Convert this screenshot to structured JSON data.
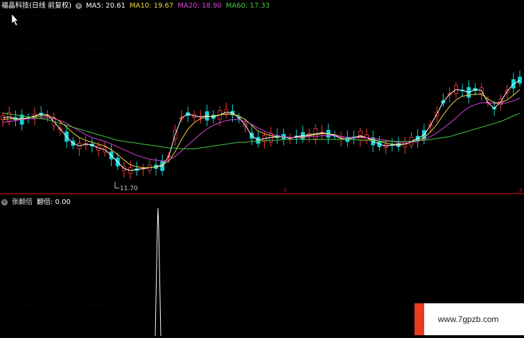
{
  "main_legend": {
    "title": "福晶科技(日线 前复权)",
    "ma5_label": "MA5: 20.61",
    "ma10_label": "MA10: 19.67",
    "ma20_label": "MA20: 18.90",
    "ma60_label": "MA60: 17.33",
    "colors": {
      "title": "#ffffff",
      "ma5": "#ffffff",
      "ma10": "#f5d64a",
      "ma20": "#e040e0",
      "ma60": "#44cc44"
    }
  },
  "main_chart": {
    "low_marker_label": "11.70",
    "axis_marker_left": "S",
    "axis_marker_right": "S"
  },
  "sub_legend": {
    "title": "张翻倍",
    "value_label": "翻倍: 0.00"
  },
  "watermark": {
    "url": "www.7gpzb.com"
  },
  "chart_data": [
    {
      "type": "line",
      "title": "福晶科技(日线 前复权)",
      "series": [
        {
          "name": "MA5",
          "last": 20.61,
          "values": [
            18.6,
            18.7,
            18.5,
            18.4,
            18.6,
            18.8,
            19.0,
            18.9,
            18.2,
            17.4,
            16.6,
            15.9,
            15.6,
            15.8,
            15.7,
            15.4,
            15.2,
            14.6,
            13.9,
            13.2,
            13.0,
            13.1,
            13.2,
            13.3,
            13.4,
            13.5,
            14.5,
            16.8,
            18.6,
            19.0,
            18.8,
            18.7,
            18.8,
            18.7,
            18.9,
            19.2,
            19.1,
            18.6,
            17.8,
            16.7,
            16.2,
            16.4,
            16.5,
            16.6,
            16.6,
            16.4,
            16.6,
            16.7,
            16.8,
            16.9,
            17.0,
            16.9,
            16.7,
            16.4,
            16.3,
            16.5,
            16.7,
            16.5,
            16.1,
            15.8,
            15.6,
            15.7,
            15.7,
            15.8,
            16.1,
            16.4,
            16.8,
            17.8,
            19.0,
            20.3,
            21.1,
            21.6,
            21.5,
            21.3,
            21.6,
            21.5,
            20.2,
            19.6,
            20.3,
            21.4,
            22.2,
            22.6
          ]
        },
        {
          "name": "MA10",
          "last": 19.67,
          "values": [
            18.4,
            18.5,
            18.5,
            18.5,
            18.6,
            18.7,
            18.8,
            18.8,
            18.6,
            18.2,
            17.6,
            17.0,
            16.5,
            16.2,
            16.0,
            15.8,
            15.6,
            15.2,
            14.7,
            14.1,
            13.6,
            13.4,
            13.3,
            13.3,
            13.4,
            13.6,
            14.0,
            15.0,
            16.3,
            17.4,
            18.1,
            18.5,
            18.7,
            18.8,
            18.9,
            19.0,
            19.0,
            18.8,
            18.4,
            17.8,
            17.2,
            16.9,
            16.7,
            16.6,
            16.6,
            16.5,
            16.5,
            16.6,
            16.7,
            16.8,
            16.9,
            16.9,
            16.8,
            16.6,
            16.5,
            16.5,
            16.6,
            16.5,
            16.3,
            16.1,
            15.9,
            15.8,
            15.8,
            15.8,
            16.0,
            16.2,
            16.5,
            17.1,
            17.9,
            18.9,
            19.8,
            20.5,
            20.9,
            21.0,
            21.1,
            21.1,
            20.6,
            20.2,
            20.2,
            20.5,
            21.0,
            21.6
          ]
        },
        {
          "name": "MA20",
          "last": 18.9,
          "values": [
            18.1,
            18.2,
            18.3,
            18.4,
            18.5,
            18.5,
            18.6,
            18.6,
            18.5,
            18.3,
            18.0,
            17.6,
            17.2,
            16.8,
            16.5,
            16.3,
            16.1,
            15.8,
            15.5,
            15.2,
            14.9,
            14.6,
            14.4,
            14.2,
            14.1,
            14.0,
            14.1,
            14.5,
            15.1,
            15.7,
            16.3,
            16.9,
            17.4,
            17.8,
            18.1,
            18.3,
            18.4,
            18.4,
            18.2,
            17.9,
            17.5,
            17.2,
            16.9,
            16.7,
            16.6,
            16.5,
            16.5,
            16.5,
            16.6,
            16.6,
            16.7,
            16.7,
            16.7,
            16.6,
            16.5,
            16.5,
            16.5,
            16.5,
            16.4,
            16.3,
            16.2,
            16.1,
            16.0,
            15.9,
            16.0,
            16.1,
            16.3,
            16.6,
            17.0,
            17.5,
            18.0,
            18.6,
            19.2,
            19.7,
            20.0,
            20.2,
            20.2,
            20.1,
            20.1,
            20.2,
            20.4,
            20.7
          ]
        },
        {
          "name": "MA60",
          "last": 17.33,
          "values": [
            19.1,
            19.0,
            18.9,
            18.8,
            18.7,
            18.6,
            18.5,
            18.4,
            18.2,
            18.0,
            17.8,
            17.6,
            17.4,
            17.2,
            17.0,
            16.8,
            16.6,
            16.4,
            16.2,
            16.1,
            16.0,
            15.9,
            15.8,
            15.7,
            15.6,
            15.5,
            15.4,
            15.4,
            15.3,
            15.3,
            15.3,
            15.4,
            15.5,
            15.6,
            15.7,
            15.8,
            15.9,
            16.0,
            16.0,
            16.1,
            16.1,
            16.2,
            16.2,
            16.2,
            16.3,
            16.3,
            16.3,
            16.3,
            16.3,
            16.3,
            16.3,
            16.3,
            16.3,
            16.3,
            16.3,
            16.3,
            16.2,
            16.2,
            16.2,
            16.1,
            16.1,
            16.1,
            16.1,
            16.1,
            16.1,
            16.2,
            16.2,
            16.3,
            16.4,
            16.5,
            16.6,
            16.8,
            17.0,
            17.2,
            17.4,
            17.6,
            17.8,
            18.0,
            18.2,
            18.5,
            18.8,
            19.1
          ]
        }
      ],
      "annotations": [
        "11.70"
      ]
    },
    {
      "type": "bar",
      "title": "张翻倍",
      "series": [
        {
          "name": "翻倍",
          "last": 0.0
        }
      ],
      "spikes": [
        {
          "index": 27,
          "value": 1.0
        }
      ]
    }
  ]
}
